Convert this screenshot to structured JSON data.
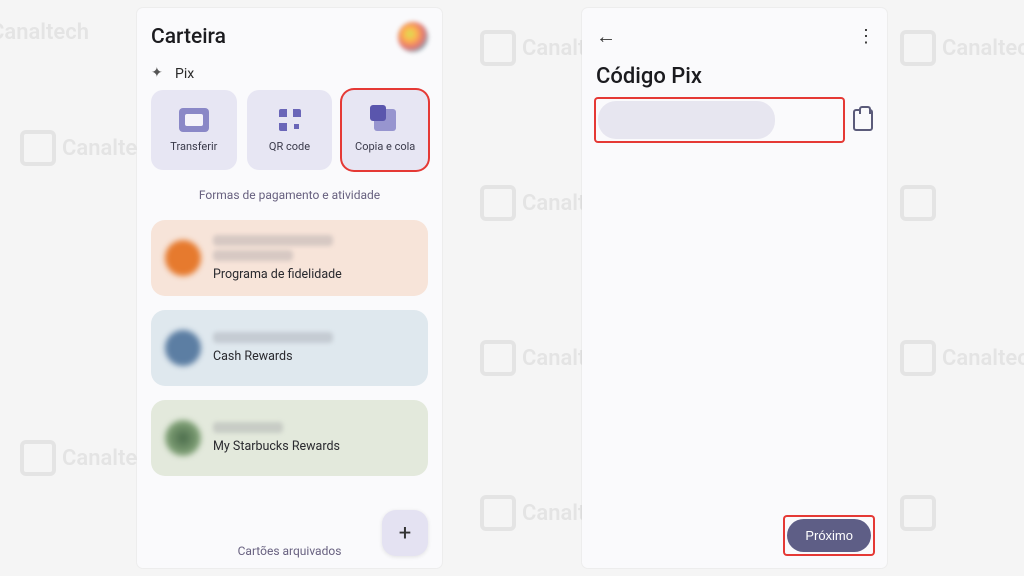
{
  "watermark_text": "Canaltech",
  "highlight_color": "#e53935",
  "left": {
    "title": "Carteira",
    "pix_label": "Pix",
    "tiles": [
      {
        "icon": "card-icon",
        "label": "Transferir"
      },
      {
        "icon": "qr-icon",
        "label": "QR code"
      },
      {
        "icon": "copy-icon",
        "label": "Copia e cola",
        "highlighted": true
      }
    ],
    "payments_link": "Formas de pagamento e atividade",
    "cards": [
      {
        "color": "orange",
        "subtitle": "Programa de fidelidade"
      },
      {
        "color": "blue",
        "subtitle": "Cash Rewards"
      },
      {
        "color": "green",
        "subtitle": "My Starbucks Rewards"
      }
    ],
    "archived_link": "Cartões arquivados",
    "fab_label": "+"
  },
  "right": {
    "title": "Código Pix",
    "input_value": "",
    "next_label": "Próximo"
  }
}
